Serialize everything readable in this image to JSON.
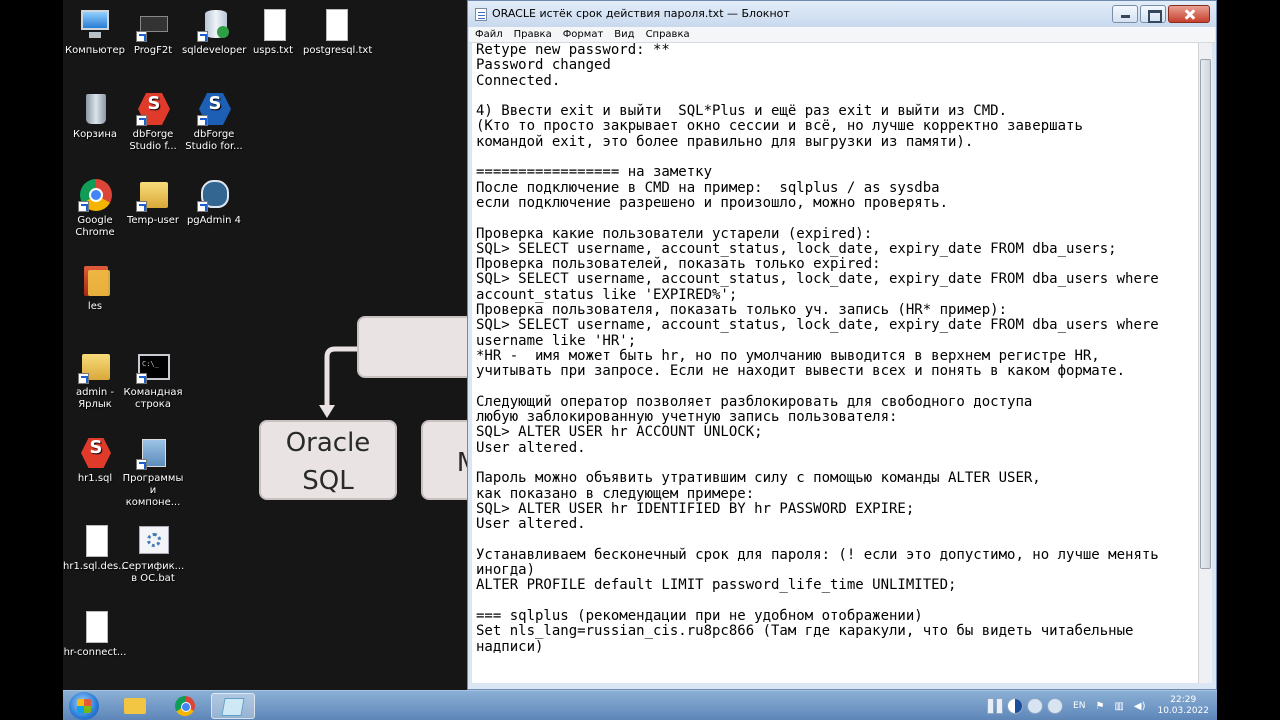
{
  "desktop": {
    "icons": [
      {
        "label": "Компьютер"
      },
      {
        "label": "ProgF2t"
      },
      {
        "label": "sqldeveloper"
      },
      {
        "label": "usps.txt"
      },
      {
        "label": "postgresql.txt"
      },
      {
        "label": "Корзина"
      },
      {
        "label": "dbForge Studio f..."
      },
      {
        "label": "dbForge Studio for..."
      },
      {
        "label": "Google Chrome"
      },
      {
        "label": "Temp-user"
      },
      {
        "label": "pgAdmin 4"
      },
      {
        "label": "les"
      },
      {
        "label": "admin - Ярлык"
      },
      {
        "label": "Командная строка"
      },
      {
        "label": "hr1.sql"
      },
      {
        "label": "Программы и компоне..."
      },
      {
        "label": "hr1.sql.des..."
      },
      {
        "label": "Сертифик... в ОС.bat"
      },
      {
        "label": "hr-connect..."
      }
    ],
    "flowchart": {
      "box_text_line1": "Oracle",
      "box_text_line2": "SQL",
      "partial_text": "M"
    }
  },
  "notepad": {
    "title": "ORACLE истёк срок действия пароля.txt — Блокнот",
    "menu": [
      "Файл",
      "Правка",
      "Формат",
      "Вид",
      "Справка"
    ],
    "content": "Retype new password: **\nPassword changed\nConnected.\n\n4) Ввести exit и выйти  SQL*Plus и ещё раз exit и выйти из CMD.\n(Кто то просто закрывает окно сессии и всё, но лучше корректно завершать\nкомандой exit, это более правильно для выгрузки из памяти).\n\n================= на заметку\nПосле подключение в CMD на пример:  sqlplus / as sysdba\nесли подключение разрешено и произошло, можно проверять.\n\nПроверка какие пользователи устарели (expired):\nSQL> SELECT username, account_status, lock_date, expiry_date FROM dba_users;\nПроверка пользователей, показать только expired:\nSQL> SELECT username, account_status, lock_date, expiry_date FROM dba_users where\naccount_status like 'EXPIRED%';\nПроверка пользователя, показать только уч. запись (HR* пример):\nSQL> SELECT username, account_status, lock_date, expiry_date FROM dba_users where\nusername like 'HR';\n*HR -  имя может быть hr, но по умолчанию выводится в верхнем регистре HR,\nучитывать при запросе. Если не находит вывести всех и понять в каком формате.\n\nСледующий оператор позволяет разблокировать для свободного доступа\nлюбую заблокированную учетную запись пользователя:\nSQL> ALTER USER hr ACCOUNT UNLOCK;\nUser altered.\n\nПароль можно объявить утратившим силу с помощью команды ALTER USER,\nкак показано в следующем примере:\nSQL> ALTER USER hr IDENTIFIED BY hr PASSWORD EXPIRE;\nUser altered.\n\nУстанавливаем бесконечный срок для пароля: (! если это допустимо, но лучше менять\nиногда)\nALTER PROFILE default LIMIT password_life_time UNLIMITED;\n\n=== sqlplus (рекомендации при не удобном отображении)\nSet nls_lang=russian_cis.ru8pc866 (Там где каракули, что бы видеть читабельные\nнадписи)"
  },
  "taskbar": {
    "lang": "EN",
    "time": "22:29",
    "date": "10.03.2022"
  },
  "colors": {
    "desktop_bg": "#161616",
    "titlebar": "#c9d9ee",
    "taskbar": "#5d86b8"
  }
}
